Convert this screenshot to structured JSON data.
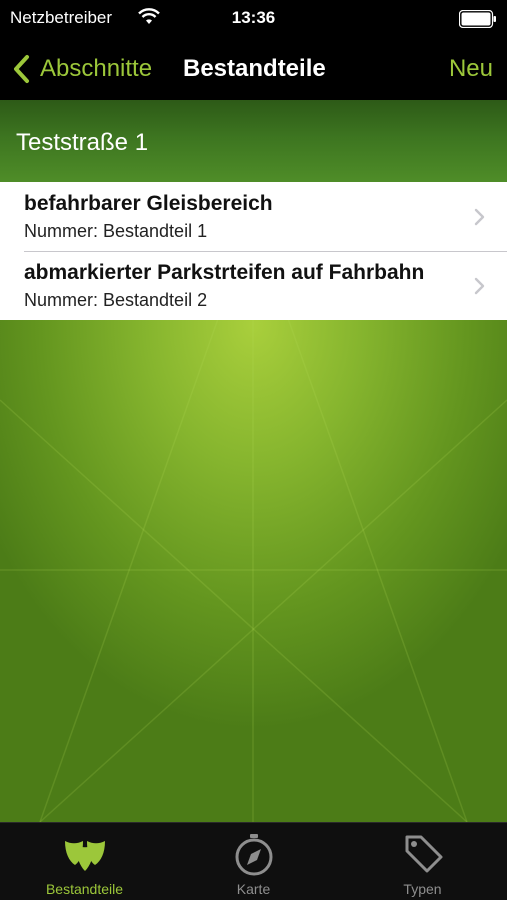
{
  "status_bar": {
    "carrier": "Netzbetreiber",
    "time": "13:36",
    "wifi_icon": "wifi-icon",
    "battery_icon": "battery-icon"
  },
  "nav_bar": {
    "back_label": "Abschnitte",
    "title": "Bestandteile",
    "new_label": "Neu",
    "accent_color": "#9cc73a"
  },
  "section": {
    "title": "Teststraße 1"
  },
  "items": [
    {
      "name": "befahrbarer Gleisbereich",
      "number": "Nummer: Bestandteil 1"
    },
    {
      "name": "abmarkierter Parkstrteifen auf Fahrbahn",
      "number": "Nummer: Bestandteil 2"
    }
  ],
  "tab_bar": {
    "tabs": [
      {
        "label": "Bestandteile",
        "icon": "leaves-icon",
        "active": true
      },
      {
        "label": "Karte",
        "icon": "compass-icon",
        "active": false
      },
      {
        "label": "Typen",
        "icon": "tag-icon",
        "active": false
      }
    ]
  }
}
